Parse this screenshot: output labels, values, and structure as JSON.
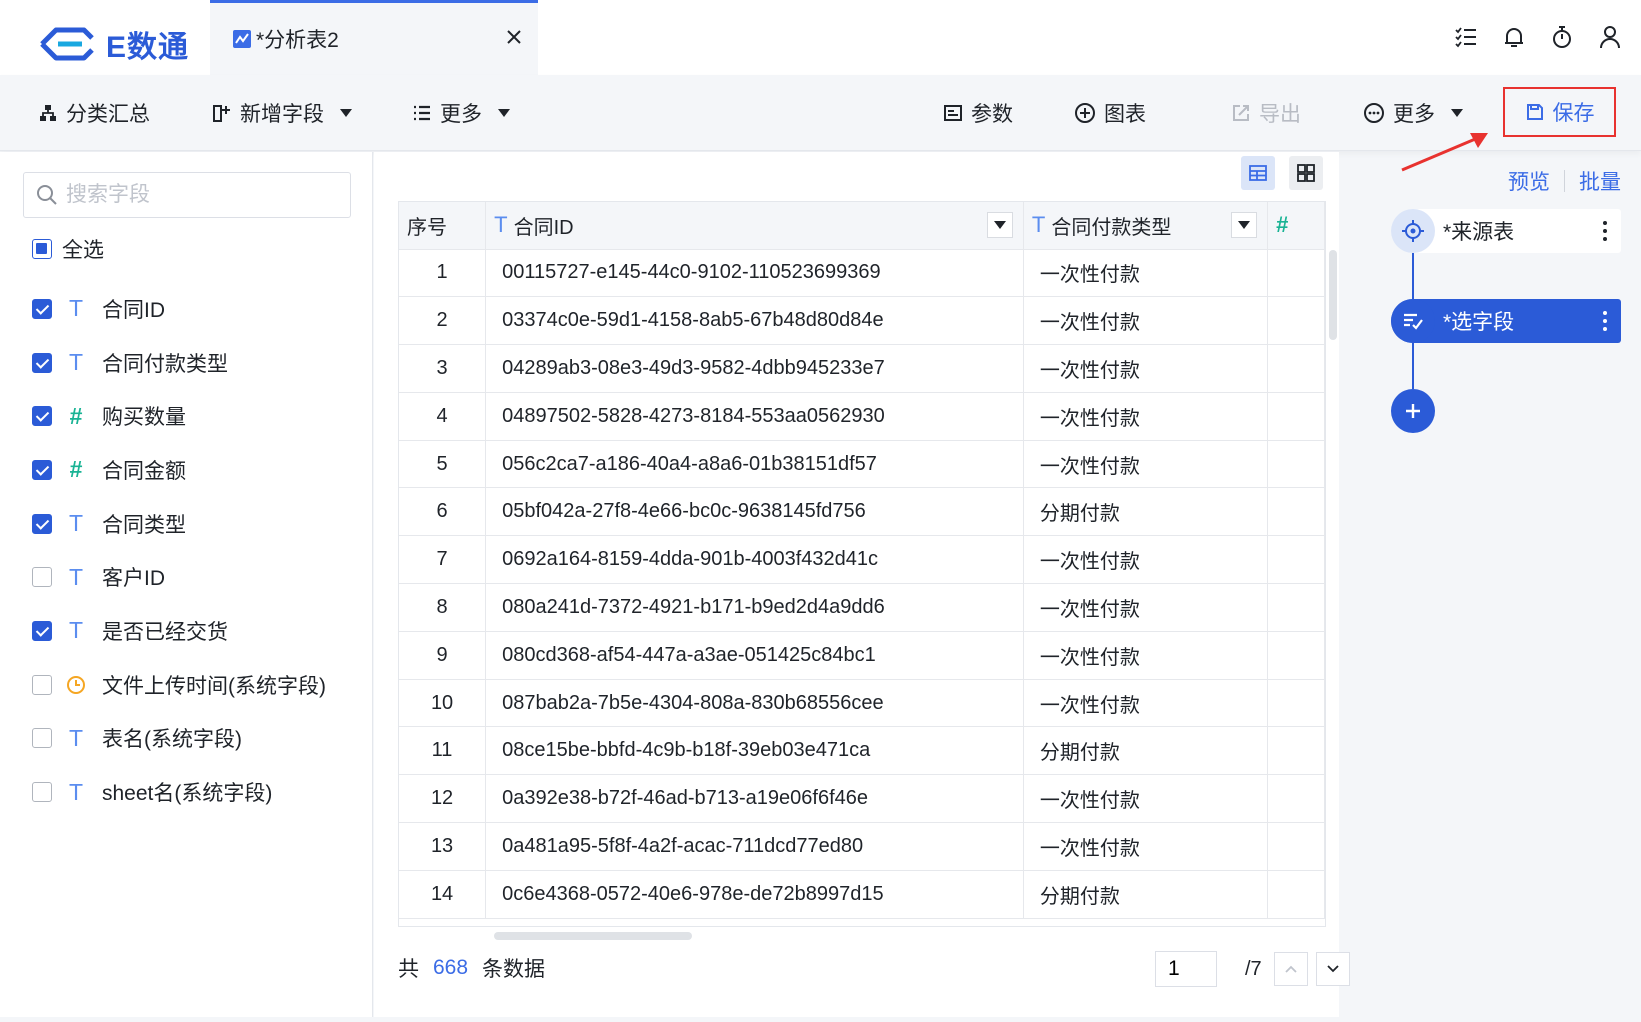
{
  "app": {
    "logo_text": "E数通"
  },
  "tab": {
    "title": "*分析表2"
  },
  "toolbar": {
    "group_summary": "分类汇总",
    "add_field": "新增字段",
    "more_left": "更多",
    "params": "参数",
    "chart": "图表",
    "export": "导出",
    "more_right": "更多",
    "save": "保存"
  },
  "left_panel": {
    "search_placeholder": "搜索字段",
    "select_all": "全选",
    "fields": [
      {
        "name": "合同ID",
        "type": "T",
        "checked": true
      },
      {
        "name": "合同付款类型",
        "type": "T",
        "checked": true
      },
      {
        "name": "购买数量",
        "type": "#",
        "checked": true
      },
      {
        "name": "合同金额",
        "type": "#",
        "checked": true
      },
      {
        "name": "合同类型",
        "type": "T",
        "checked": true
      },
      {
        "name": "客户ID",
        "type": "T",
        "checked": false
      },
      {
        "name": "是否已经交货",
        "type": "T",
        "checked": true
      },
      {
        "name": "文件上传时间(系统字段)",
        "type": "time",
        "checked": false
      },
      {
        "name": "表名(系统字段)",
        "type": "T",
        "checked": false
      },
      {
        "name": "sheet名(系统字段)",
        "type": "T",
        "checked": false
      }
    ]
  },
  "table": {
    "columns": [
      {
        "label": "序号",
        "type": ""
      },
      {
        "label": "合同ID",
        "type": "T"
      },
      {
        "label": "合同付款类型",
        "type": "T"
      },
      {
        "label": "",
        "type": "#"
      }
    ],
    "rows": [
      [
        "1",
        "00115727-e145-44c0-9102-110523699369",
        "一次性付款"
      ],
      [
        "2",
        "03374c0e-59d1-4158-8ab5-67b48d80d84e",
        "一次性付款"
      ],
      [
        "3",
        "04289ab3-08e3-49d3-9582-4dbb945233e7",
        "一次性付款"
      ],
      [
        "4",
        "04897502-5828-4273-8184-553aa0562930",
        "一次性付款"
      ],
      [
        "5",
        "056c2ca7-a186-40a4-a8a6-01b38151df57",
        "一次性付款"
      ],
      [
        "6",
        "05bf042a-27f8-4e66-bc0c-9638145fd756",
        "分期付款"
      ],
      [
        "7",
        "0692a164-8159-4dda-901b-4003f432d41c",
        "一次性付款"
      ],
      [
        "8",
        "080a241d-7372-4921-b171-b9ed2d4a9dd6",
        "一次性付款"
      ],
      [
        "9",
        "080cd368-af54-447a-a3ae-051425c84bc1",
        "一次性付款"
      ],
      [
        "10",
        "087bab2a-7b5e-4304-808a-830b68556cee",
        "一次性付款"
      ],
      [
        "11",
        "08ce15be-bbfd-4c9b-b18f-39eb03e471ca",
        "分期付款"
      ],
      [
        "12",
        "0a392e38-b72f-46ad-b713-a19e06f6f46e",
        "一次性付款"
      ],
      [
        "13",
        "0a481a95-5f8f-4a2f-acac-711dcd77ed80",
        "一次性付款"
      ],
      [
        "14",
        "0c6e4368-0572-40e6-978e-de72b8997d15",
        "分期付款"
      ]
    ]
  },
  "footer": {
    "prefix": "共",
    "count": "668",
    "suffix": "条数据",
    "current_page": "1",
    "total_pages": "/7"
  },
  "right_panel": {
    "preview": "预览",
    "batch": "批量",
    "nodes": [
      {
        "label": "*来源表"
      },
      {
        "label": "*选字段"
      }
    ]
  },
  "colors": {
    "accent": "#2b5bd7",
    "link": "#3b6ce6",
    "highlight_box": "#e8322f",
    "number_type": "#19b394",
    "text_type": "#5b8def"
  }
}
